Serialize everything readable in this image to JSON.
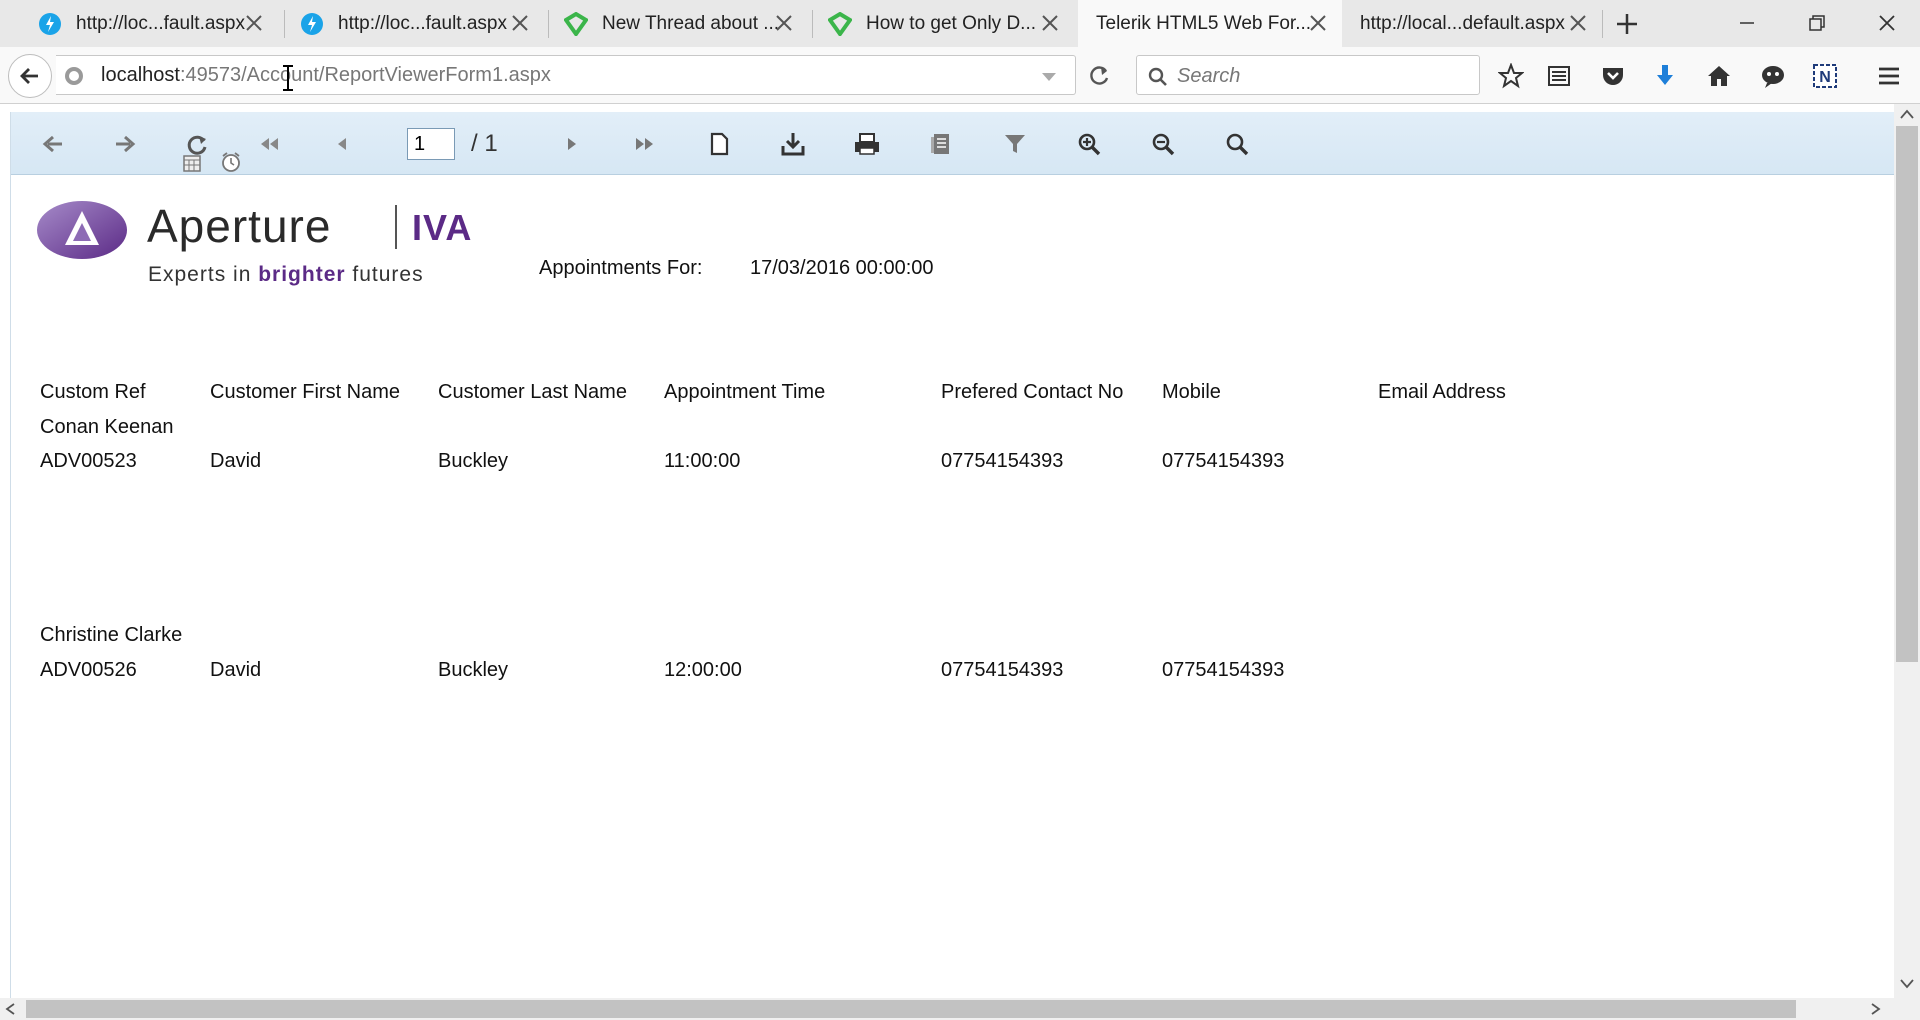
{
  "browser": {
    "tabs": [
      {
        "label": "http://loc...fault.aspx",
        "icon": "lightning-icon",
        "active": false
      },
      {
        "label": "http://loc...fault.aspx",
        "icon": "lightning-icon",
        "active": false
      },
      {
        "label": "New Thread about ...",
        "icon": "telerik-icon",
        "active": false
      },
      {
        "label": "How to get Only D...",
        "icon": "telerik-icon",
        "active": false
      },
      {
        "label": "Telerik HTML5 Web For...",
        "icon": "",
        "active": true
      },
      {
        "label": "http://local...default.aspx",
        "icon": "",
        "active": false
      }
    ],
    "url_host": "localhost",
    "url_rest": ":49573/Account/ReportViewerForm1.aspx",
    "search_placeholder": "Search"
  },
  "viewer": {
    "page_current": "1",
    "page_total": "/ 1"
  },
  "report": {
    "logo_brand": "Ap",
    "logo_brand_rest": "erture",
    "logo_iva": "IVA",
    "logo_tagline_pre": "Experts in ",
    "logo_tagline_bold": "brighter",
    "logo_tagline_post": " futures",
    "appointments_label": "Appointments For:",
    "appointments_date": "17/03/2016 00:00:00",
    "columns": [
      "Custom Ref",
      "Customer First Name",
      "Customer Last Name",
      "Appointment Time",
      "Prefered Contact No",
      "Mobile",
      "Email Address"
    ],
    "groups": [
      {
        "name": "Conan Keenan",
        "row": [
          "ADV00523",
          "David",
          "Buckley",
          "11:00:00",
          "07754154393",
          "07754154393",
          ""
        ]
      },
      {
        "name": "Christine Clarke",
        "row": [
          "ADV00526",
          "David",
          "Buckley",
          "12:00:00",
          "07754154393",
          "07754154393",
          ""
        ]
      }
    ]
  },
  "colors": {
    "accent_purple": "#5b2a86",
    "toolbar_bg": "#dceaf6"
  }
}
